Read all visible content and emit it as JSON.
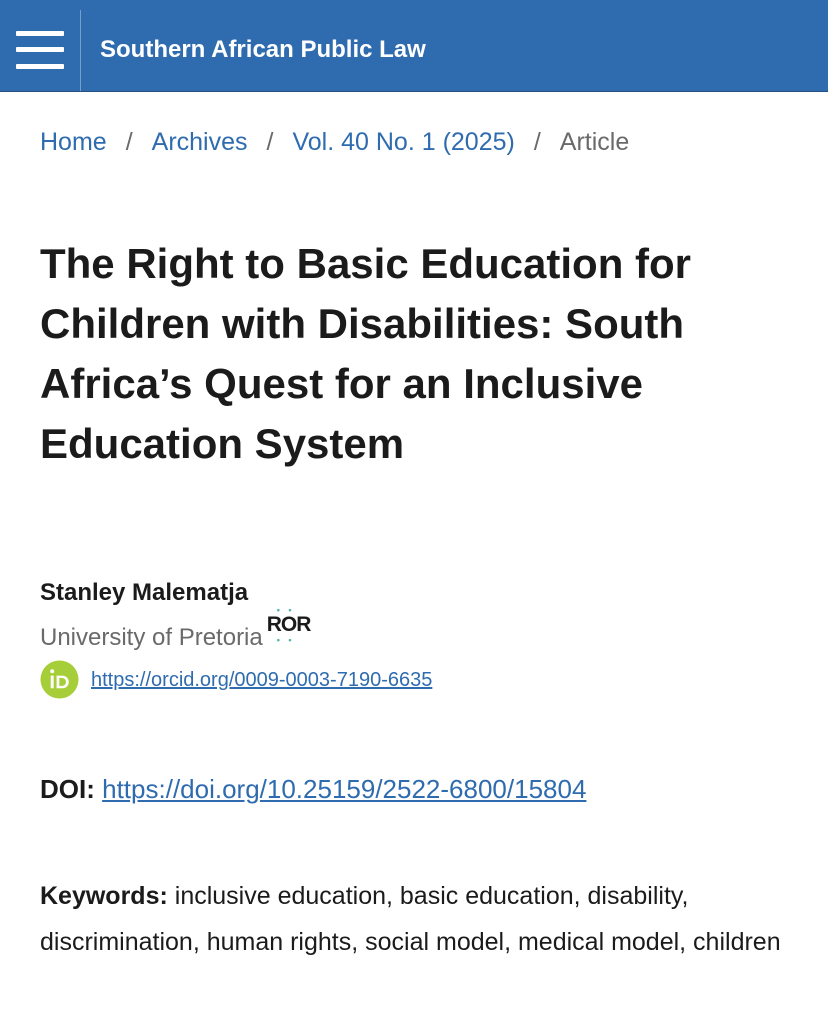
{
  "header": {
    "site_title": "Southern African Public Law",
    "menu_icon": "hamburger-menu-icon",
    "background_color": "#2f6caf"
  },
  "breadcrumb": {
    "items": [
      "Home",
      "Archives",
      "Vol. 40 No. 1 (2025)"
    ],
    "separator": "/",
    "current": "Article"
  },
  "article": {
    "title": "The Right to Basic Education for Children with Disabilities: South Africa’s Quest for an Inclusive Education System",
    "author": {
      "name": "Stanley Malematja",
      "affiliation": "University of Pretoria",
      "ror_badge": "ROR",
      "orcid_url": "https://orcid.org/0009-0003-7190-6635"
    },
    "doi": {
      "label": "DOI:",
      "url": "https://doi.org/10.25159/2522-6800/15804"
    },
    "keywords": {
      "label": "Keywords:",
      "value": "inclusive education, basic education, disability, discrimination, human rights, social model, medical model, children"
    }
  },
  "colors": {
    "link": "#2f6caf",
    "orcid_green": "#a6ce39",
    "ror_teal": "#4fb3a8",
    "muted_text": "#6a6a6a"
  }
}
